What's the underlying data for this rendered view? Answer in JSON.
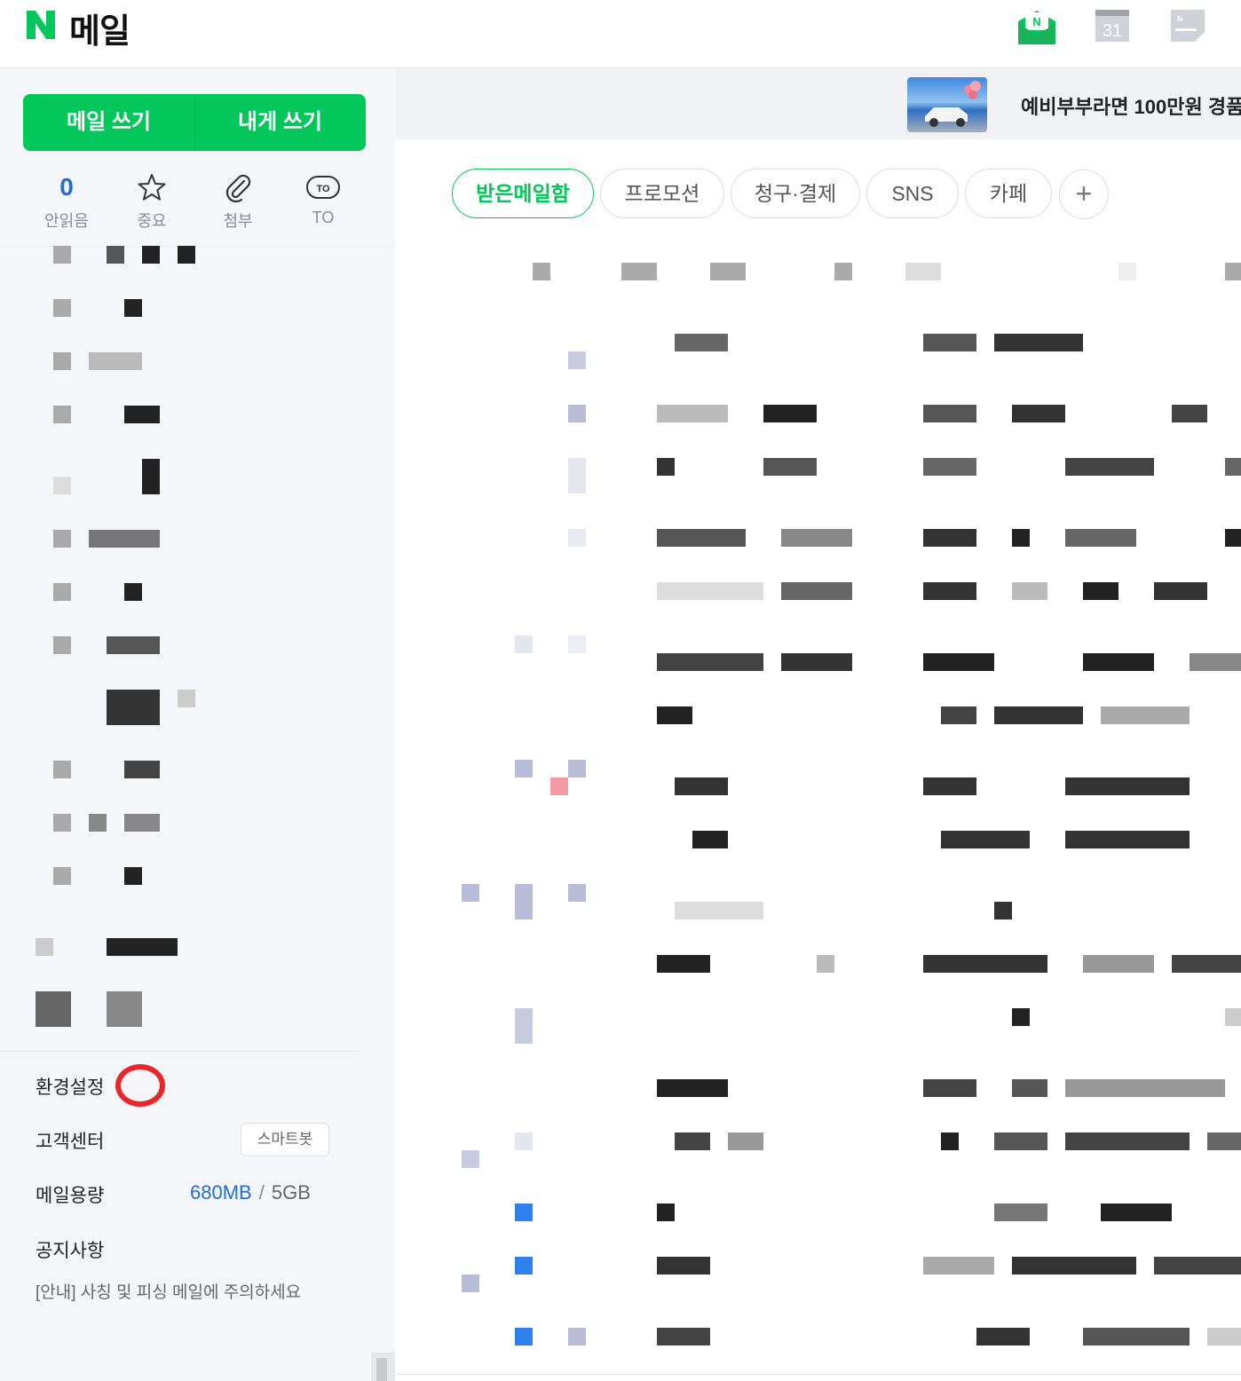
{
  "header": {
    "logo_letter": "N",
    "title": "메일",
    "icons": [
      "naver-mail-icon",
      "calendar-icon",
      "memo-icon"
    ],
    "calendar_day": "31"
  },
  "sidebar": {
    "compose_label": "메일 쓰기",
    "self_compose_label": "내게 쓰기",
    "quick_filters": [
      {
        "label": "안읽음",
        "value": "0",
        "icon": "unread-count"
      },
      {
        "label": "중요",
        "icon": "star-icon"
      },
      {
        "label": "첨부",
        "icon": "paperclip-icon"
      },
      {
        "label": "TO",
        "icon": "to-badge-icon",
        "badge": "TO"
      }
    ],
    "settings_label": "환경설정",
    "support_label": "고객센터",
    "smartbot_label": "스마트봇",
    "storage_label": "메일용량",
    "storage_used": "680MB",
    "storage_separator": "/",
    "storage_total": "5GB",
    "notice_label": "공지사항",
    "notice_text": "[안내] 사칭 및 피싱 메일에 주의하세요"
  },
  "banner": {
    "text": "예비부부라면 100만원 경품"
  },
  "folder_tabs": [
    {
      "label": "받은메일함",
      "active": true
    },
    {
      "label": "프로모션",
      "active": false
    },
    {
      "label": "청구·결제",
      "active": false
    },
    {
      "label": "SNS",
      "active": false
    },
    {
      "label": "카페",
      "active": false
    }
  ],
  "add_tab_label": "+",
  "colors": {
    "brand_green": "#03c75a",
    "accent_blue": "#1f6ed4",
    "highlight_red": "#e8262b",
    "sidebar_bg": "#f5f6f9"
  }
}
